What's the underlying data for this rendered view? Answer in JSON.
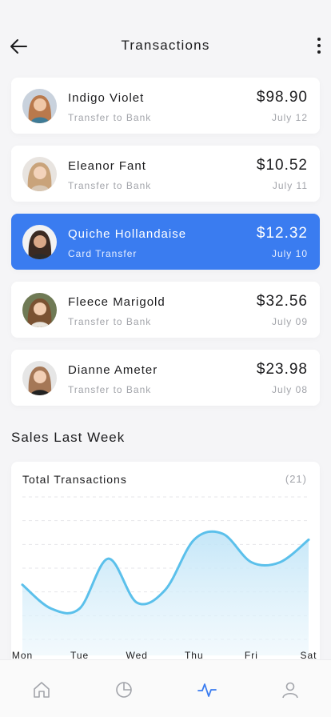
{
  "header": {
    "title": "Transactions"
  },
  "transactions": [
    {
      "name": "Indigo Violet",
      "type": "Transfer to Bank",
      "amount": "$98.90",
      "date": "July 12",
      "active": false
    },
    {
      "name": "Eleanor Fant",
      "type": "Transfer to Bank",
      "amount": "$10.52",
      "date": "July 11",
      "active": false
    },
    {
      "name": "Quiche Hollandaise",
      "type": "Card Transfer",
      "amount": "$12.32",
      "date": "July 10",
      "active": true
    },
    {
      "name": "Fleece Marigold",
      "type": "Transfer to Bank",
      "amount": "$32.56",
      "date": "July 09",
      "active": false
    },
    {
      "name": "Dianne Ameter",
      "type": "Transfer to Bank",
      "amount": "$23.98",
      "date": "July 08",
      "active": false
    }
  ],
  "section": {
    "title": "Sales Last Week"
  },
  "chart_card": {
    "title": "Total Transactions",
    "count": "(21)"
  },
  "chart_data": {
    "type": "area",
    "title": "Total Transactions",
    "categories": [
      "Mon",
      "Tue",
      "Wed",
      "Thu",
      "Fri",
      "Sat"
    ],
    "x": [
      "Mon",
      "",
      "Tue",
      "",
      "Wed",
      "",
      "",
      "Thu",
      "",
      "Fri",
      "",
      "Sat"
    ],
    "values": [
      4.6,
      2.6,
      2.6,
      6.8,
      3.1,
      4.2,
      8.4,
      8.9,
      6.5,
      6.5,
      8.4
    ],
    "ylim": [
      0,
      12
    ],
    "grid": true,
    "color": "#5bc0eb"
  },
  "tabs": [
    {
      "name": "home",
      "icon": "home-icon",
      "active": false
    },
    {
      "name": "stats",
      "icon": "pie-chart-icon",
      "active": false
    },
    {
      "name": "activity",
      "icon": "activity-icon",
      "active": true
    },
    {
      "name": "profile",
      "icon": "user-icon",
      "active": false
    }
  ],
  "colors": {
    "accent": "#3a7cf0",
    "line": "#5bc0eb",
    "muted": "#a2a4aa"
  }
}
